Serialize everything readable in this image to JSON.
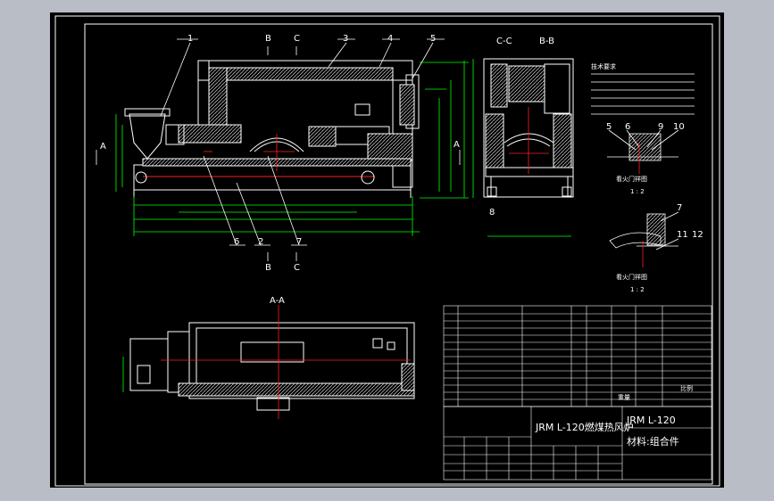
{
  "colors": {
    "viewport_bg": "#b8bdc6",
    "paper": "#000000",
    "lines": "#ffffff",
    "dims": "#00ff00",
    "centerline": "#ff2020",
    "hatch": "#ffffff",
    "frame": "#ffff00"
  },
  "main_view": {
    "part_numbers_top": [
      "1",
      "B",
      "C",
      "3",
      "4",
      "5"
    ],
    "part_numbers_bottom": [
      "6",
      "2",
      "7"
    ],
    "section_marks": {
      "top_b": "B",
      "top_c": "C",
      "bottom_b": "B",
      "bottom_c": "C",
      "left_a": "A",
      "right_a": "A"
    }
  },
  "section_views": {
    "cc": "C-C",
    "bb": "B-B",
    "part_8": "8"
  },
  "details": {
    "detail1_parts": [
      "5",
      "6",
      "9",
      "10"
    ],
    "detail1_caption": "看火门祥图",
    "detail1_scale": "1 : 2",
    "detail2_parts": [
      "7",
      "11",
      "12"
    ],
    "detail2_caption": "看火门祥图",
    "detail2_scale": "1 : 2"
  },
  "notes_title": "技术要求",
  "plan_view": {
    "label": "A-A"
  },
  "title_block": {
    "drawing_name": "JRM L-120燃煤热风炉",
    "drawing_code": "JRM L-120",
    "material": "材料:组合件",
    "qty_label_1": "重量",
    "qty_label_2": "比例"
  }
}
